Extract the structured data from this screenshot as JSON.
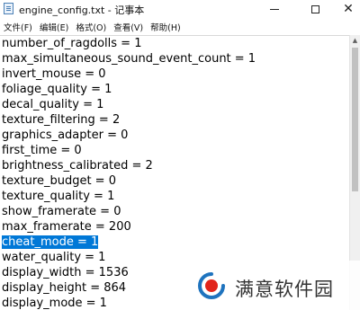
{
  "window": {
    "title": "engine_config.txt - 记事本",
    "minimize_icon": "minimize-icon",
    "maximize_icon": "maximize-icon",
    "close_icon": "close-icon"
  },
  "menu": [
    "文件(F)",
    "编辑(E)",
    "格式(O)",
    "查看(V)",
    "帮助(H)"
  ],
  "lines": [
    "number_of_ragdolls = 1",
    "max_simultaneous_sound_event_count = 1",
    "invert_mouse = 0",
    "foliage_quality = 1",
    "decal_quality = 1",
    "texture_filtering = 2",
    "graphics_adapter = 0",
    "first_time = 0",
    "brightness_calibrated = 2",
    "texture_budget = 0",
    "texture_quality = 1",
    "show_framerate = 0",
    "max_framerate = 200",
    "cheat_mode = 1",
    "water_quality = 1",
    "display_width = 1536",
    "display_height = 864",
    "display_mode = 1"
  ],
  "selected_line": "cheat_mode = 1",
  "watermark": {
    "text": "满意软件园",
    "logo": "watermark-logo",
    "colors": {
      "logo_red": "#e1251b",
      "logo_blue": "#1e73be"
    }
  },
  "colors": {
    "selection": "#0078d7",
    "text": "#000000",
    "scrollbar_thumb": "#c1c1c1"
  }
}
